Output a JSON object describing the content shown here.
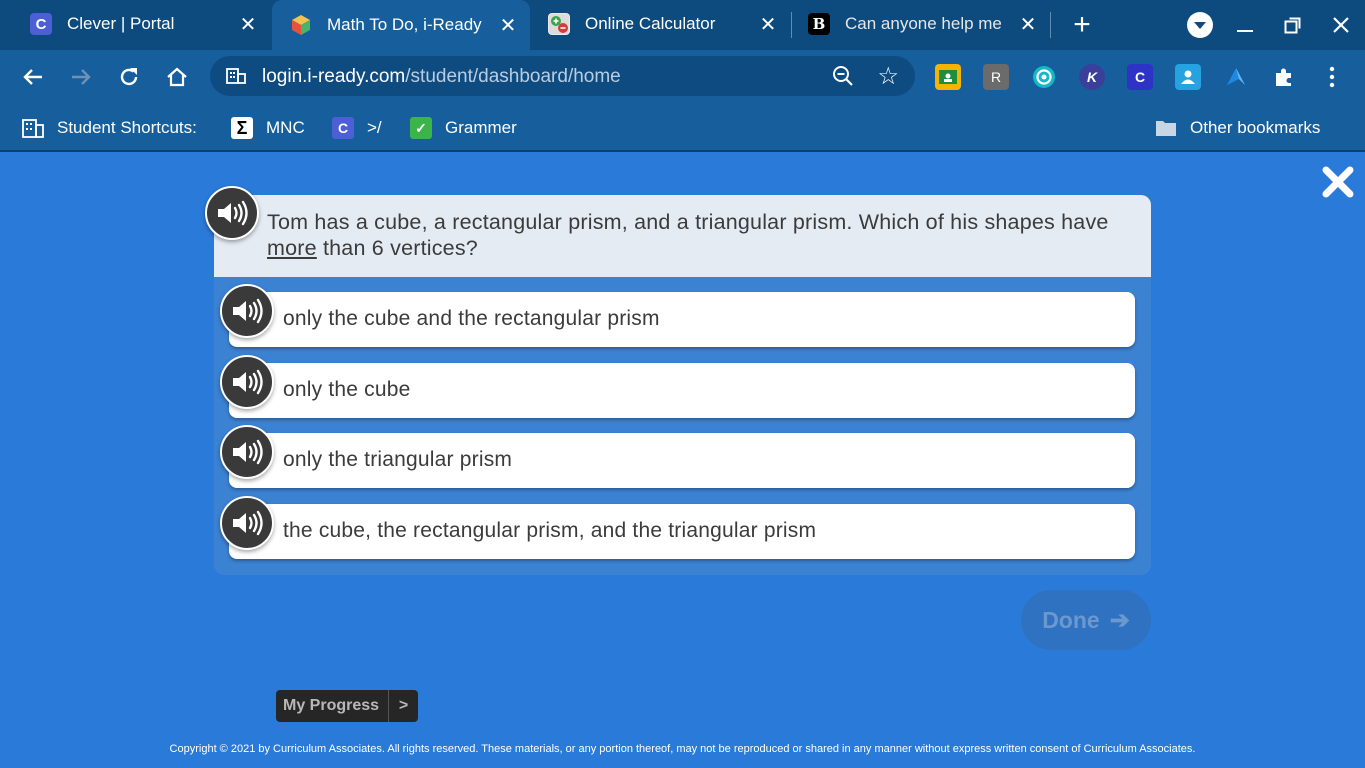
{
  "browser": {
    "tabs": [
      {
        "title": "Clever | Portal",
        "favicon": "C",
        "favicon_color": "#4c5fd5",
        "active": false
      },
      {
        "title": "Math To Do, i-Ready",
        "favicon": "cube",
        "favicon_color": "#e8a33a",
        "active": true
      },
      {
        "title": "Online Calculator",
        "favicon": "calculator",
        "favicon_color": "#4caf50",
        "active": false
      },
      {
        "title": "Can anyone help me",
        "favicon": "B",
        "favicon_color": "#000000",
        "active": false
      }
    ],
    "new_tab_label": "+",
    "url_host": "login.i-ready.com",
    "url_path": "/student/dashboard/home",
    "extensions": [
      {
        "name": "google-classroom-icon",
        "label": "",
        "color": "#f4b400"
      },
      {
        "name": "r-extension-icon",
        "label": "R",
        "color": "#6b6b6b"
      },
      {
        "name": "target-extension-icon",
        "label": "",
        "color": "#14b8c8"
      },
      {
        "name": "k-extension-icon",
        "label": "K",
        "color": "#3b3f9c"
      },
      {
        "name": "c-extension-icon",
        "label": "C",
        "color": "#2d33c4"
      },
      {
        "name": "contact-extension-icon",
        "label": "",
        "color": "#25a3e0"
      },
      {
        "name": "bird-extension-icon",
        "label": "",
        "color": "#1e88e5"
      },
      {
        "name": "puzzle-icon",
        "label": "",
        "color": "transparent"
      }
    ]
  },
  "bookmarks": {
    "items": [
      {
        "label": "Student Shortcuts:",
        "icon": "building"
      },
      {
        "label": "MNC",
        "icon": "sigma"
      },
      {
        "label": ">/",
        "icon": "C"
      },
      {
        "label": "Grammer",
        "icon": "check"
      }
    ],
    "other_label": "Other bookmarks"
  },
  "question": {
    "text_before": "Tom has a cube, a rectangular prism, and a triangular prism. Which of his shapes have ",
    "emphasis": "more",
    "text_after": " than 6 vertices?"
  },
  "answers": [
    {
      "label": "only the cube and the rectangular prism"
    },
    {
      "label": "only the cube"
    },
    {
      "label": "only the triangular prism"
    },
    {
      "label": "the cube, the rectangular prism, and the triangular prism"
    }
  ],
  "done_label": "Done",
  "done_arrow": "➔",
  "progress": {
    "label": "My Progress",
    "chevron": ">"
  },
  "copyright": "Copyright © 2021 by Curriculum Associates. All rights reserved. These materials, or any portion thereof, may not be reproduced or shared in any manner without express written consent of Curriculum Associates."
}
